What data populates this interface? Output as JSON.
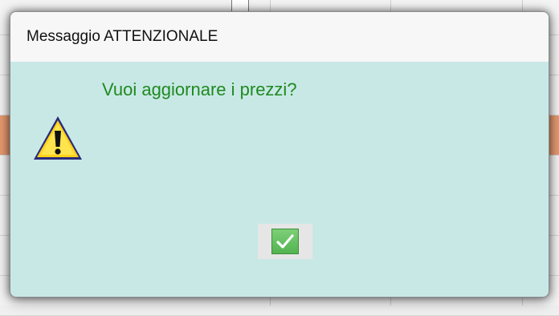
{
  "dialog": {
    "title": "Messaggio ATTENZIONALE",
    "message": "Vuoi aggiornare i prezzi?",
    "icon": "warning-icon",
    "ok_button_icon": "checkmark-icon"
  },
  "colors": {
    "dialog_background": "#c8e8e6",
    "message_text": "#1f8a1f",
    "highlight_row": "#e79a70"
  }
}
